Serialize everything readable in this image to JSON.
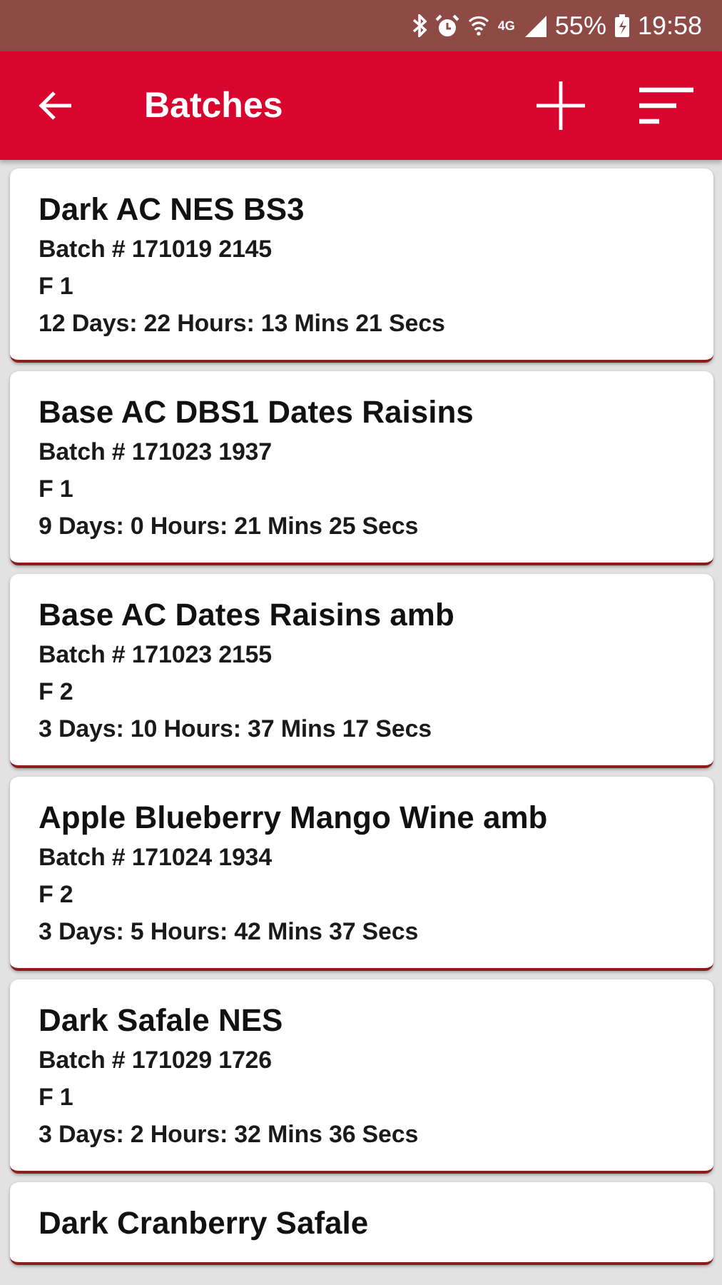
{
  "status_bar": {
    "network_type": "4G",
    "battery": "55%",
    "time": "19:58"
  },
  "app_bar": {
    "title": "Batches"
  },
  "batches": [
    {
      "name": "Dark AC NES BS3",
      "batch": "Batch # 171019 2145",
      "stage": "F 1",
      "elapsed": "12 Days: 22 Hours: 13 Mins 21 Secs"
    },
    {
      "name": "Base AC DBS1 Dates Raisins",
      "batch": "Batch # 171023 1937",
      "stage": "F 1",
      "elapsed": "9 Days: 0 Hours: 21 Mins 25 Secs"
    },
    {
      "name": "Base AC Dates Raisins amb",
      "batch": "Batch # 171023 2155",
      "stage": "F 2",
      "elapsed": "3 Days: 10 Hours: 37 Mins 17 Secs"
    },
    {
      "name": "Apple Blueberry Mango Wine amb",
      "batch": "Batch # 171024 1934",
      "stage": "F 2",
      "elapsed": "3 Days: 5 Hours: 42 Mins 37 Secs"
    },
    {
      "name": "Dark Safale NES",
      "batch": "Batch # 171029 1726",
      "stage": "F 1",
      "elapsed": "3 Days: 2 Hours: 32 Mins 36 Secs"
    },
    {
      "name": "Dark Cranberry Safale"
    }
  ]
}
